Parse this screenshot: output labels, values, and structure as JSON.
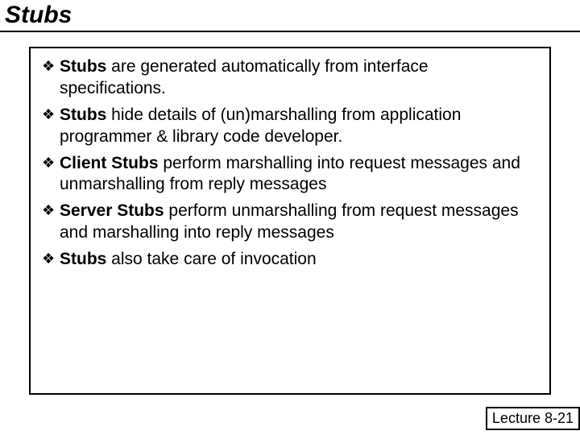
{
  "title": "Stubs",
  "bullet_glyph": "❖",
  "items": [
    {
      "bold": "Stubs",
      "rest": " are generated automatically from interface specifications."
    },
    {
      "bold": "Stubs",
      "rest": " hide details of (un)marshalling from application programmer & library code developer."
    },
    {
      "bold": "Client Stubs",
      "rest": " perform marshalling into request messages and unmarshalling from reply messages"
    },
    {
      "bold": "Server Stubs",
      "rest": " perform unmarshalling from request messages and marshalling into reply messages"
    },
    {
      "bold": "Stubs",
      "rest": " also take care of invocation"
    }
  ],
  "footer": "Lecture 8-21"
}
